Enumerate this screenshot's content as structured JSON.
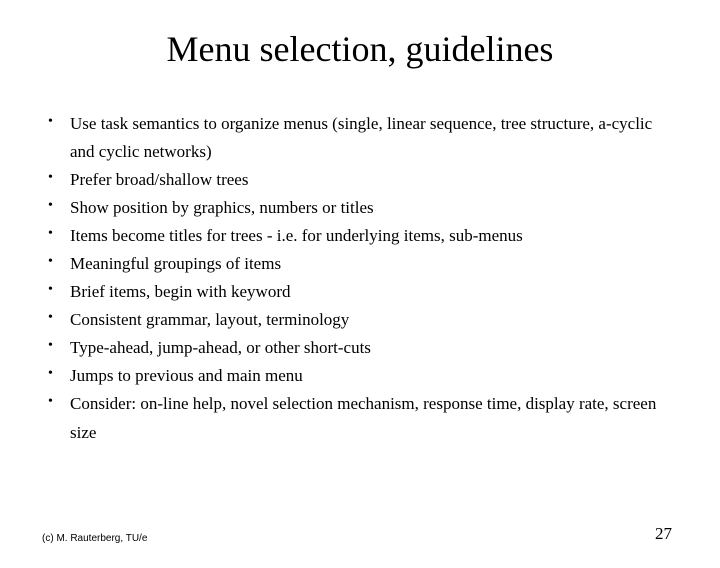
{
  "title": "Menu selection, guidelines",
  "bullets": [
    "Use task semantics to organize menus (single, linear sequence, tree structure, a-cyclic and cyclic networks)",
    "Prefer broad/shallow trees",
    "Show position by graphics, numbers or titles",
    "Items become titles for trees - i.e. for underlying items, sub-menus",
    "Meaningful groupings of items",
    "Brief items, begin with keyword",
    "Consistent grammar, layout, terminology",
    "Type-ahead, jump-ahead, or other short-cuts",
    "Jumps to previous and main menu",
    "Consider:  on-line help, novel selection mechanism, response time, display rate, screen size"
  ],
  "footer": {
    "copyright": "(c) M. Rauterberg, TU/e",
    "page": "27"
  }
}
